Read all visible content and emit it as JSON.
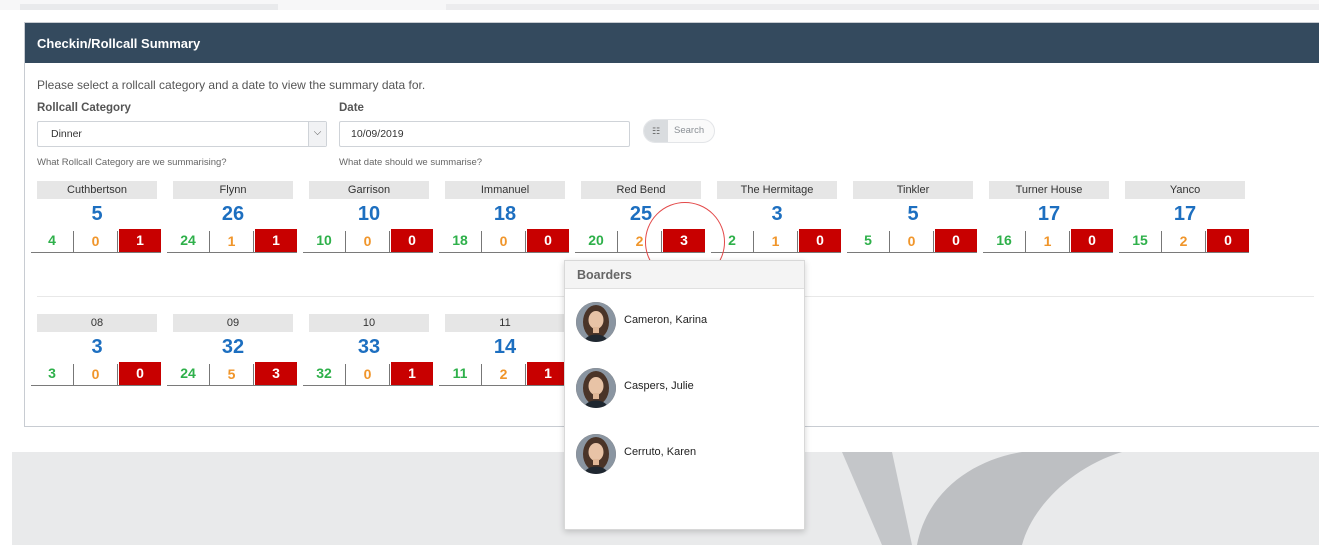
{
  "panel": {
    "title": "Checkin/Rollcall Summary",
    "intro": "Please select a rollcall category and a date to view the summary data for."
  },
  "filters": {
    "category_label": "Rollcall Category",
    "category_value": "Dinner",
    "category_hint": "What Rollcall Category are we summarising?",
    "date_label": "Date",
    "date_value": "10/09/2019",
    "date_hint": "What date should we summarise?",
    "search_label": "Search",
    "search_icon": "calendar-search-icon"
  },
  "houses": [
    {
      "name": "Cuthbertson",
      "total": "5",
      "present": "4",
      "late": "0",
      "absent": "1"
    },
    {
      "name": "Flynn",
      "total": "26",
      "present": "24",
      "late": "1",
      "absent": "1"
    },
    {
      "name": "Garrison",
      "total": "10",
      "present": "10",
      "late": "0",
      "absent": "0"
    },
    {
      "name": "Immanuel",
      "total": "18",
      "present": "18",
      "late": "0",
      "absent": "0"
    },
    {
      "name": "Red Bend",
      "total": "25",
      "present": "20",
      "late": "2",
      "absent": "3"
    },
    {
      "name": "The Hermitage",
      "total": "3",
      "present": "2",
      "late": "1",
      "absent": "0"
    },
    {
      "name": "Tinkler",
      "total": "5",
      "present": "5",
      "late": "0",
      "absent": "0"
    },
    {
      "name": "Turner House",
      "total": "17",
      "present": "16",
      "late": "1",
      "absent": "0"
    },
    {
      "name": "Yanco",
      "total": "17",
      "present": "15",
      "late": "2",
      "absent": "0"
    }
  ],
  "years": [
    {
      "name": "08",
      "total": "3",
      "present": "3",
      "late": "0",
      "absent": "0"
    },
    {
      "name": "09",
      "total": "32",
      "present": "24",
      "late": "5",
      "absent": "3"
    },
    {
      "name": "10",
      "total": "33",
      "present": "32",
      "late": "0",
      "absent": "1"
    },
    {
      "name": "11",
      "total": "14",
      "present": "11",
      "late": "2",
      "absent": "1"
    }
  ],
  "popup": {
    "title": "Boarders",
    "items": [
      {
        "name": "Cameron, Karina"
      },
      {
        "name": "Caspers, Julie"
      },
      {
        "name": "Cerruto, Karen"
      }
    ]
  },
  "colors": {
    "header": "#344a5e",
    "total": "#1d6fc0",
    "present": "#2eb04a",
    "late": "#f0952a",
    "absent": "#c80000",
    "highlight": "#e34848"
  }
}
